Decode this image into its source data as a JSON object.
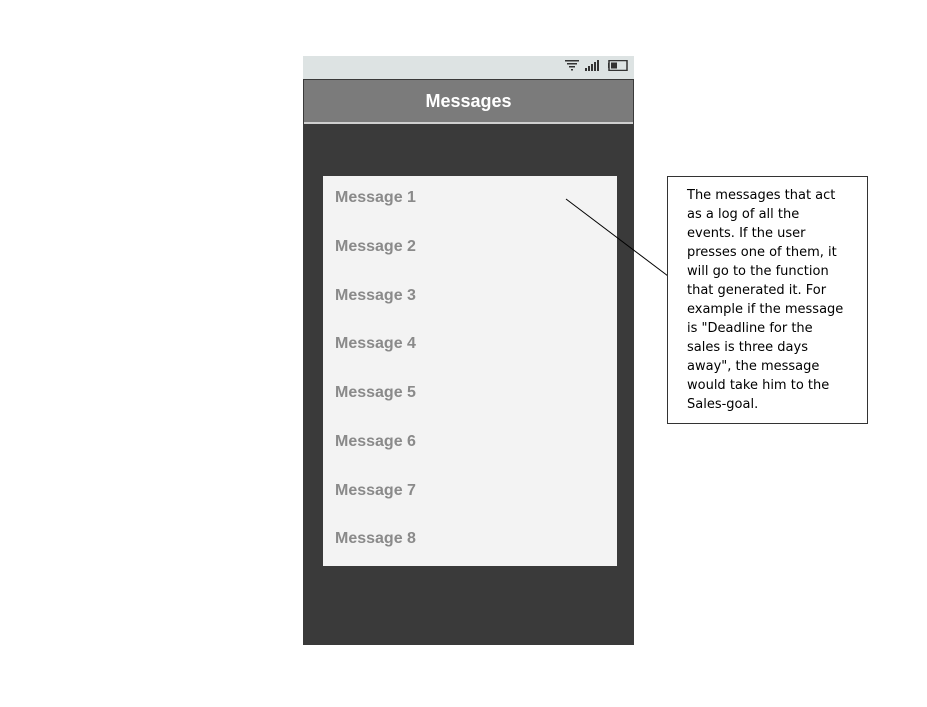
{
  "app": {
    "title": "Messages"
  },
  "status_bar": {
    "icons": [
      "wifi-icon",
      "signal-icon",
      "battery-icon"
    ]
  },
  "messages": [
    {
      "label": "Message 1"
    },
    {
      "label": "Message 2"
    },
    {
      "label": "Message 3"
    },
    {
      "label": "Message 4"
    },
    {
      "label": "Message 5"
    },
    {
      "label": "Message 6"
    },
    {
      "label": "Message 7"
    },
    {
      "label": "Message 8"
    }
  ],
  "annotation": {
    "text": "The messages that act as a log of all the events. If the user presses one of them, it will go to the function that generated it. For example if the message is \"Deadline for the sales is three days away\", the message would take him to the Sales-goal."
  },
  "colors": {
    "phone_background": "#3a3a3a",
    "status_bar": "#dde3e3",
    "header": "#7b7b7b",
    "list_background": "#f3f3f3",
    "message_text": "#8a8a8a"
  }
}
